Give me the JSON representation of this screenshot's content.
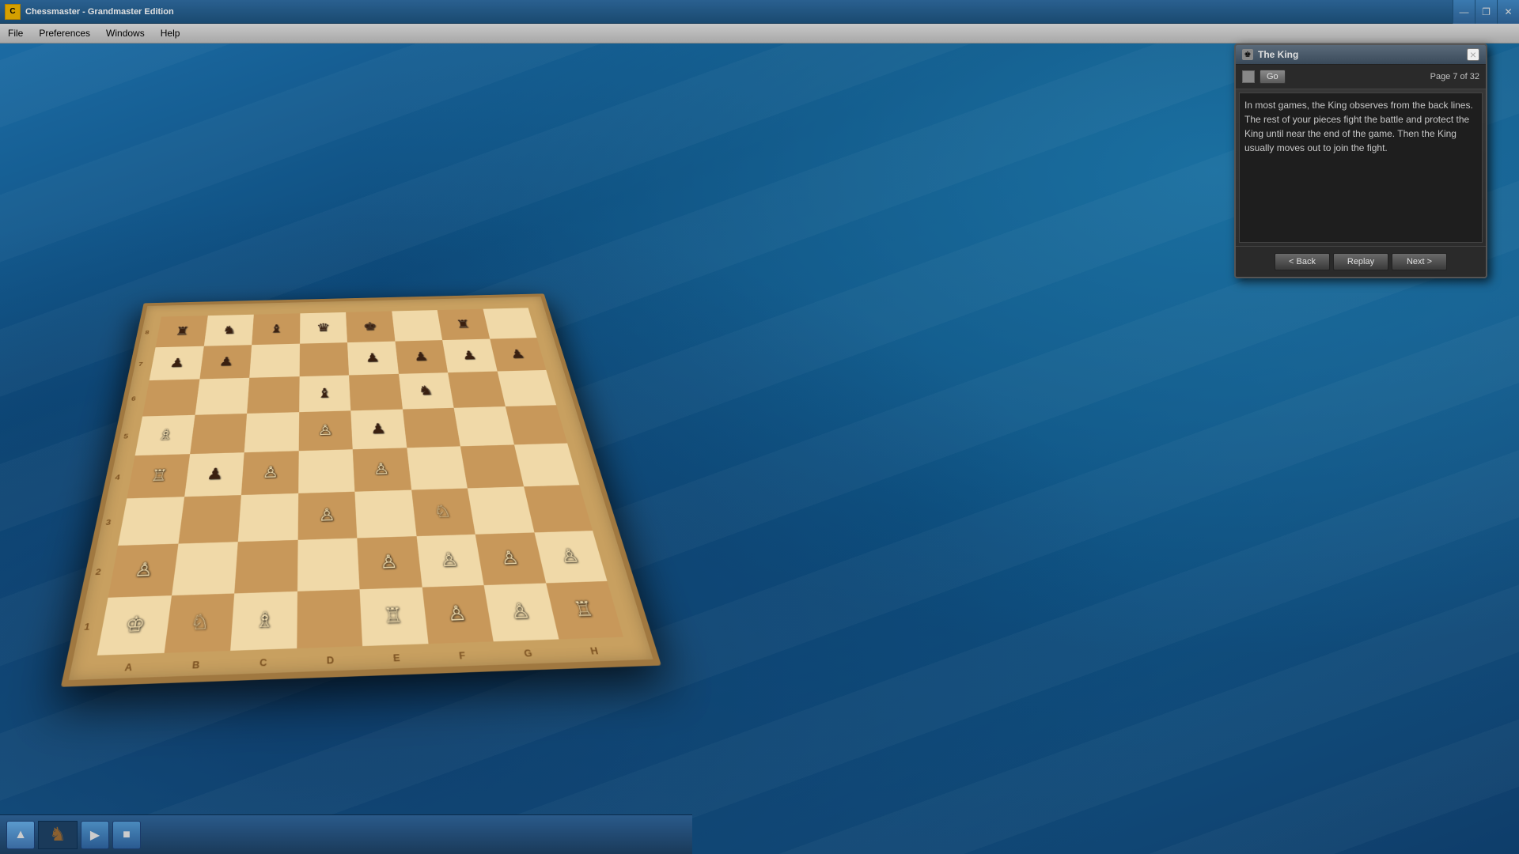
{
  "app": {
    "title": "Chessmaster - Grandmaster Edition",
    "logo_letter": "C"
  },
  "titlebar": {
    "minimize_label": "—",
    "maximize_label": "❐",
    "close_label": "✕"
  },
  "menubar": {
    "items": [
      "File",
      "Preferences",
      "Windows",
      "Help"
    ]
  },
  "lesson_panel": {
    "title": "The King",
    "close_label": "×",
    "go_label": "Go",
    "page_info": "Page 7 of 32",
    "content": "In most games, the King observes from the back lines. The rest of your pieces fight the battle and protect the King until near the end of the game. Then the King usually moves out to join the fight.",
    "back_label": "< Back",
    "replay_label": "Replay",
    "next_label": "Next >"
  },
  "board": {
    "rank_labels": [
      "8",
      "7",
      "6",
      "5",
      "4",
      "3",
      "2",
      "1"
    ],
    "file_labels": [
      "A",
      "B",
      "C",
      "D",
      "E",
      "F",
      "G",
      "H"
    ]
  },
  "toolbar": {
    "up_arrow": "▲",
    "play_label": "▶",
    "stop_label": "■"
  }
}
